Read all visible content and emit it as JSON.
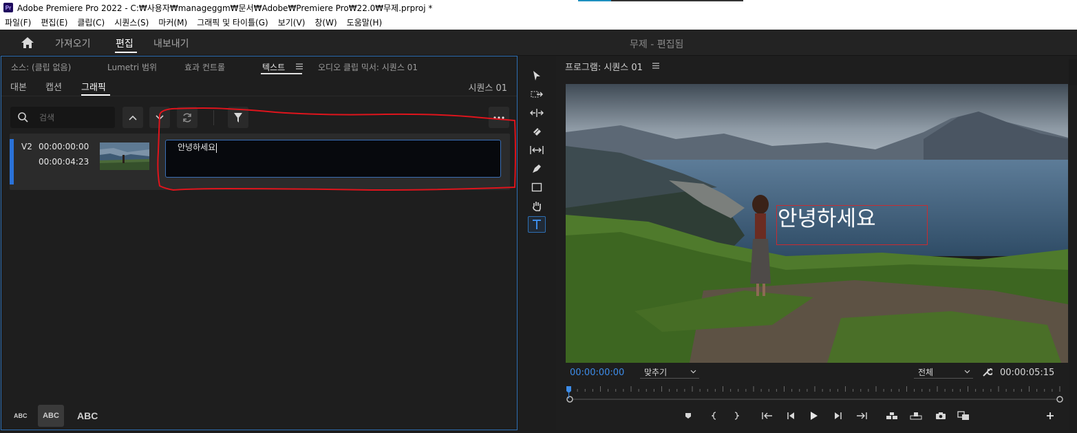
{
  "titlebar": {
    "app_icon": "Pr",
    "title": "Adobe Premiere Pro 2022 - C:₩사용자₩manageggm₩문서₩Adobe₩Premiere Pro₩22.0₩무제.prproj *"
  },
  "menu": [
    "파일(F)",
    "편집(E)",
    "클립(C)",
    "시퀀스(S)",
    "마커(M)",
    "그래픽 및 타이틀(G)",
    "보기(V)",
    "창(W)",
    "도움말(H)"
  ],
  "workspace": {
    "tabs": [
      "가져오기",
      "편집",
      "내보내기"
    ],
    "active_tab": "편집",
    "project_title": "무제 - 편집됨"
  },
  "left_panel": {
    "tabs": [
      "소스: (클립 없음)",
      "Lumetri 범위",
      "효과 컨트롤",
      "텍스트",
      "오디오 클립 믹서: 시퀀스 01"
    ],
    "active_tab": "텍스트",
    "subtabs": [
      "대본",
      "캡션",
      "그래픽"
    ],
    "active_subtab": "그래픽",
    "sequence_label": "시퀀스 01",
    "search_placeholder": "검색",
    "clip": {
      "track": "V2",
      "in_time": "00:00:00:00",
      "out_time": "00:00:04:23",
      "text": "안녕하세요"
    },
    "style_buttons": [
      "ABC",
      "ABC",
      "ABC"
    ]
  },
  "tools": [
    "selection-tool-icon",
    "track-select-icon",
    "ripple-edit-icon",
    "razor-icon",
    "slip-icon",
    "pen-icon",
    "rectangle-icon",
    "hand-icon",
    "type-tool-icon"
  ],
  "program_monitor": {
    "title": "프로그램: 시퀀스 01",
    "overlay_text": "안녕하세요",
    "timecode_current": "00:00:00:00",
    "zoom": "맞추기",
    "resolution": "전체",
    "timecode_total": "00:00:05:15"
  },
  "colors": {
    "accent_blue": "#2d6fb4",
    "timecode_blue": "#3d8ce8",
    "annotation_red": "#e0141c"
  }
}
